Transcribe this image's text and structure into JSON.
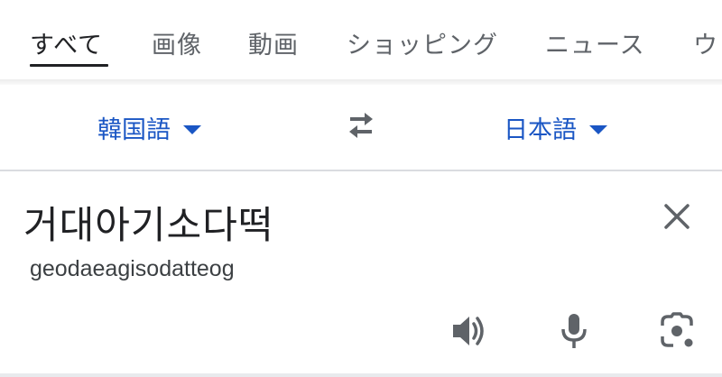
{
  "tabs": [
    {
      "label": "すべて",
      "active": true
    },
    {
      "label": "画像",
      "active": false
    },
    {
      "label": "動画",
      "active": false
    },
    {
      "label": "ショッピング",
      "active": false
    },
    {
      "label": "ニュース",
      "active": false
    },
    {
      "label": "ウ",
      "active": false
    }
  ],
  "translate": {
    "source_lang": "韓国語",
    "target_lang": "日本語",
    "source_text": "거대아기소다떡",
    "romanization": "geodaeagisodatteog"
  },
  "icons": {
    "swap": "swap-arrows-icon",
    "clear": "close-icon",
    "speaker": "speaker-icon",
    "microphone": "microphone-icon",
    "camera": "camera-lens-icon"
  },
  "colors": {
    "accent": "#1a56c4",
    "text": "#202124",
    "icon": "#5f6368"
  }
}
